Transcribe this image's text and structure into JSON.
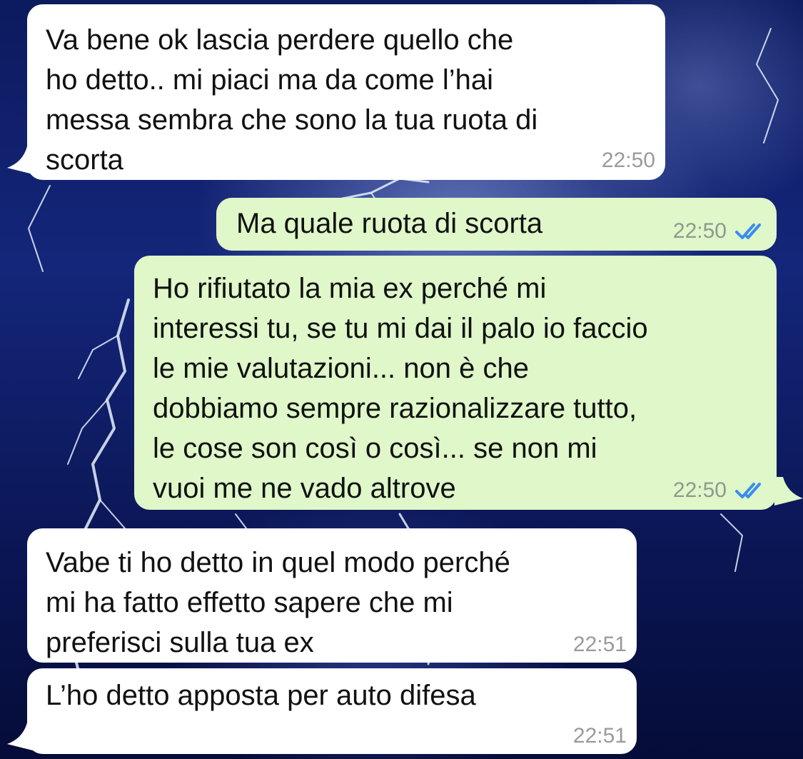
{
  "chat": {
    "messages": [
      {
        "direction": "incoming",
        "text": "Va bene ok lascia perdere quello che\nho detto.. mi piaci ma da come l’hai\nmessa sembra che sono la tua ruota di\nscorta",
        "time": "22:50"
      },
      {
        "direction": "outgoing",
        "text": "Ma quale ruota di scorta",
        "time": "22:50",
        "status_icon": "double-check-icon"
      },
      {
        "direction": "outgoing",
        "text": "Ho rifiutato la mia ex perché mi\ninteressi tu, se tu mi dai il palo io faccio\nle mie valutazioni... non è che\ndobbiamo sempre razionalizzare tutto,\nle cose son così o così... se non mi\nvuoi me ne vado altrove",
        "time": "22:50",
        "status_icon": "double-check-icon"
      },
      {
        "direction": "incoming",
        "text": "Vabe ti ho detto in quel modo perché\nmi ha fatto effetto sapere che mi\npreferisci sulla tua ex",
        "time": "22:51"
      },
      {
        "direction": "incoming",
        "text": "L’ho detto apposta per auto difesa",
        "time": "22:51"
      }
    ]
  },
  "colors": {
    "incoming_bubble": "#ffffff",
    "outgoing_bubble": "#dff7c9",
    "read_ticks": "#3b8cf0",
    "wallpaper": "#0c1a5e"
  }
}
